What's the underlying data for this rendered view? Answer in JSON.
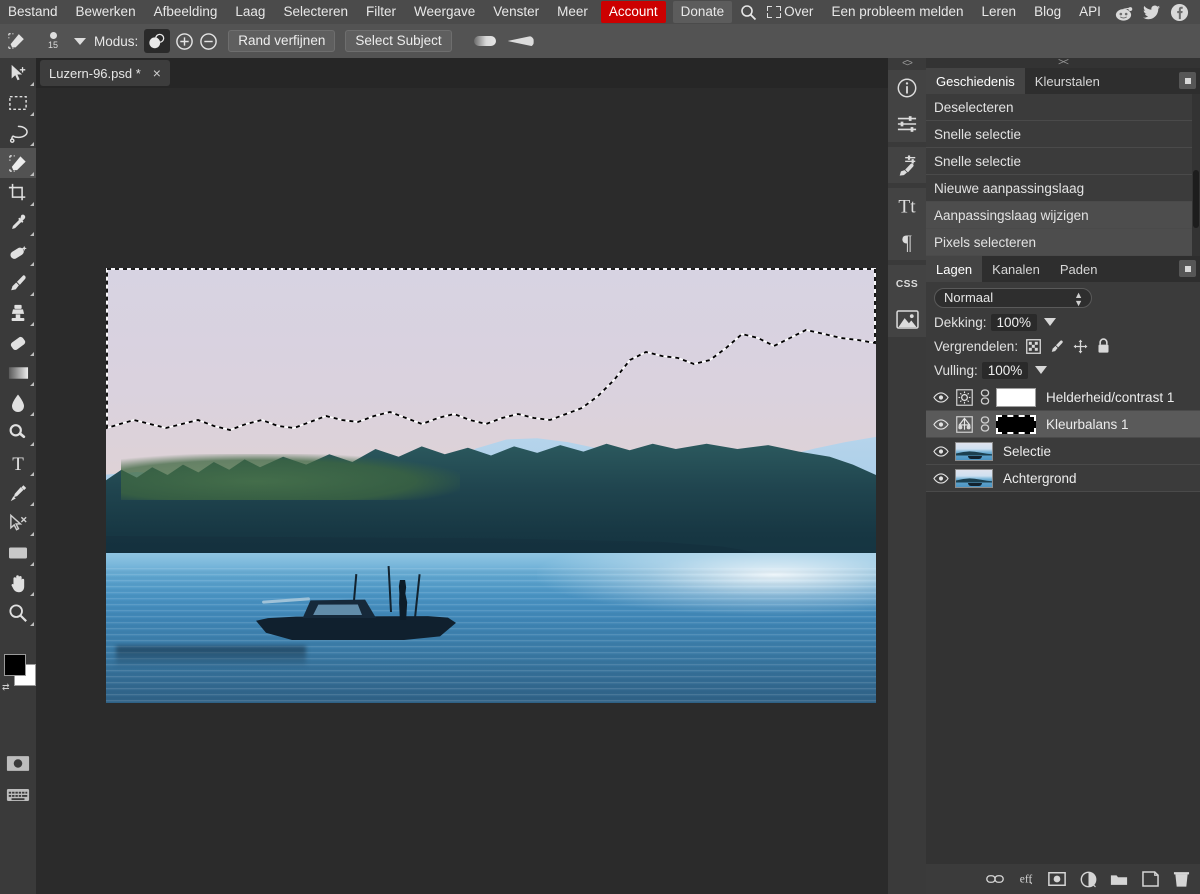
{
  "menubar": {
    "items": [
      "Bestand",
      "Bewerken",
      "Afbeelding",
      "Laag",
      "Selecteren",
      "Filter",
      "Weergave",
      "Venster",
      "Meer"
    ],
    "account_label": "Account",
    "donate_label": "Donate",
    "search_icon": "search-icon",
    "about_label": "Over",
    "report_label": "Een probleem melden",
    "learn_label": "Leren",
    "blog_label": "Blog",
    "api_label": "API",
    "social": [
      "reddit-icon",
      "twitter-icon",
      "facebook-icon"
    ],
    "accent_color": "#cc0000",
    "bar_color": "#4b4b4b"
  },
  "options_bar": {
    "tool_icon": "quick-selection-icon",
    "brush_size": "15",
    "mode_label": "Modus:",
    "mode_new_icon": "selection-new-icon",
    "mode_add_icon": "selection-add-icon",
    "mode_subtract_icon": "selection-subtract-icon",
    "refine_edge_label": "Rand verfijnen",
    "select_subject_label": "Select Subject",
    "hardness_icon": "hardness-swatch",
    "taper_icon": "taper-swatch"
  },
  "tabs": {
    "documents": [
      {
        "name": "Luzern-96.psd *",
        "close": "×",
        "active": true
      }
    ]
  },
  "toolbar": {
    "tools": [
      {
        "name": "move-tool",
        "active": false
      },
      {
        "name": "rectangular-marquee-tool",
        "active": false
      },
      {
        "name": "lasso-tool",
        "active": false
      },
      {
        "name": "quick-selection-tool",
        "active": true
      },
      {
        "name": "crop-tool",
        "active": false
      },
      {
        "name": "eyedropper-tool",
        "active": false
      },
      {
        "name": "healing-brush-tool",
        "active": false
      },
      {
        "name": "brush-tool",
        "active": false
      },
      {
        "name": "clone-stamp-tool",
        "active": false
      },
      {
        "name": "eraser-tool",
        "active": false
      },
      {
        "name": "gradient-tool",
        "active": false
      },
      {
        "name": "blur-tool",
        "active": false
      },
      {
        "name": "dodge-tool",
        "active": false
      },
      {
        "name": "type-tool",
        "active": false
      },
      {
        "name": "pen-tool",
        "active": false
      },
      {
        "name": "path-selection-tool",
        "active": false
      },
      {
        "name": "shape-tool",
        "active": false
      },
      {
        "name": "hand-tool",
        "active": false
      },
      {
        "name": "zoom-tool",
        "active": false
      }
    ],
    "foreground_color": "#000000",
    "background_color": "#ffffff",
    "screen_mode_icon": "screen-mode-icon",
    "keyboard_icon": "keyboard-icon"
  },
  "rail": {
    "buttons": [
      "info-icon",
      "adjustments-icon",
      "brush-settings-icon",
      "character-icon",
      "paragraph-icon",
      "css-icon",
      "image-icon"
    ]
  },
  "history_panel": {
    "tabs": [
      {
        "label": "Geschiedenis",
        "active": true
      },
      {
        "label": "Kleurstalen",
        "active": false
      }
    ],
    "menu_icon": "panel-menu-icon",
    "items": [
      {
        "label": "Deselecteren",
        "selected": false
      },
      {
        "label": "Snelle selectie",
        "selected": false
      },
      {
        "label": "Snelle selectie",
        "selected": false
      },
      {
        "label": "Nieuwe aanpassingslaag",
        "selected": false
      },
      {
        "label": "Aanpassingslaag wijzigen",
        "selected": true
      },
      {
        "label": "Pixels selecteren",
        "selected": true
      }
    ]
  },
  "layers_panel": {
    "tabs": [
      {
        "label": "Lagen",
        "active": true
      },
      {
        "label": "Kanalen",
        "active": false
      },
      {
        "label": "Paden",
        "active": false
      }
    ],
    "menu_icon": "panel-menu-icon",
    "blend_mode": "Normaal",
    "opacity_label": "Dekking:",
    "opacity_value": "100%",
    "lock_label": "Vergrendelen:",
    "lock_icons": [
      "lock-transparency-icon",
      "lock-pixels-icon",
      "lock-position-icon",
      "lock-all-icon"
    ],
    "fill_label": "Vulling:",
    "fill_value": "100%",
    "layers": [
      {
        "name": "Helderheid/contrast 1",
        "visible": true,
        "selected": false,
        "type": "adjustment",
        "adjustment_icon": "brightness-contrast-icon",
        "link_icon": "link-icon",
        "mask": "white"
      },
      {
        "name": "Kleurbalans 1",
        "visible": true,
        "selected": true,
        "type": "adjustment",
        "adjustment_icon": "color-balance-icon",
        "link_icon": "link-icon",
        "mask": "black-selected"
      },
      {
        "name": "Selectie",
        "visible": true,
        "selected": false,
        "type": "pixel",
        "thumbnail": "lake-photo-thumb"
      },
      {
        "name": "Achtergrond",
        "visible": true,
        "selected": false,
        "type": "pixel",
        "thumbnail": "lake-photo-thumb"
      }
    ],
    "bottom_buttons": [
      "link-layers-icon",
      "layer-styles-icon",
      "add-mask-icon",
      "new-adjustment-icon",
      "new-group-icon",
      "new-layer-icon",
      "delete-layer-icon"
    ]
  },
  "canvas": {
    "document_name": "Luzern-96.psd",
    "image_alt": "Lake Lucerne with fishing boat and silhouetted angler at dusk",
    "selection_active": true,
    "selection_label": "marching-ants-sky-selection"
  },
  "colors": {
    "menu_bar": "#4b4b4b",
    "options_bar": "#535353",
    "toolbar": "#3a3a3a",
    "panel": "#3b3b3b",
    "panel_tabbar": "#2e2e2e",
    "workspace": "#2b2b2b",
    "selected_row": "#5a5a5a",
    "accent_red": "#cc0000"
  }
}
